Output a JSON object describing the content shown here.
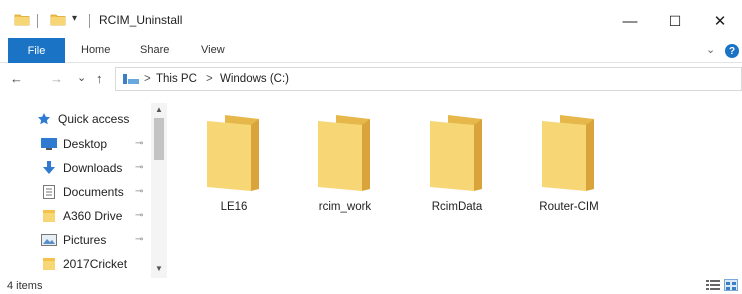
{
  "window": {
    "title": "RCIM_Uninstall",
    "controls": {
      "minimize": "—",
      "maximize": "☐",
      "close": "✕"
    },
    "quick_access_dropdown": "▾"
  },
  "ribbon": {
    "tabs": [
      "File",
      "Home",
      "Share",
      "View"
    ],
    "expand_chevron": "⌄",
    "help": "?"
  },
  "address": {
    "back": "←",
    "forward": "→",
    "recent": "⌄",
    "up": "↑",
    "breadcrumbs": [
      "This PC",
      "Windows (C:)"
    ],
    "separator": ">"
  },
  "nav": {
    "quick_access": "Quick access",
    "items": [
      {
        "label": "Desktop",
        "icon": "desktop-icon",
        "pinned": true
      },
      {
        "label": "Downloads",
        "icon": "download-icon",
        "pinned": true
      },
      {
        "label": "Documents",
        "icon": "document-icon",
        "pinned": true
      },
      {
        "label": "A360 Drive",
        "icon": "folder-icon",
        "pinned": true
      },
      {
        "label": "Pictures",
        "icon": "pictures-icon",
        "pinned": true
      },
      {
        "label": "2017Cricket",
        "icon": "folder-icon",
        "pinned": false
      }
    ],
    "pin_glyph": "📌",
    "scroll_up": "▲",
    "scroll_down": "▼"
  },
  "content": {
    "folders": [
      "LE16",
      "rcim_work",
      "RcimData",
      "Router-CIM"
    ]
  },
  "status": {
    "item_count": "4 items"
  },
  "colors": {
    "accent": "#1a73c5",
    "folder_front": "#f7d675",
    "folder_back": "#e6b84c"
  }
}
